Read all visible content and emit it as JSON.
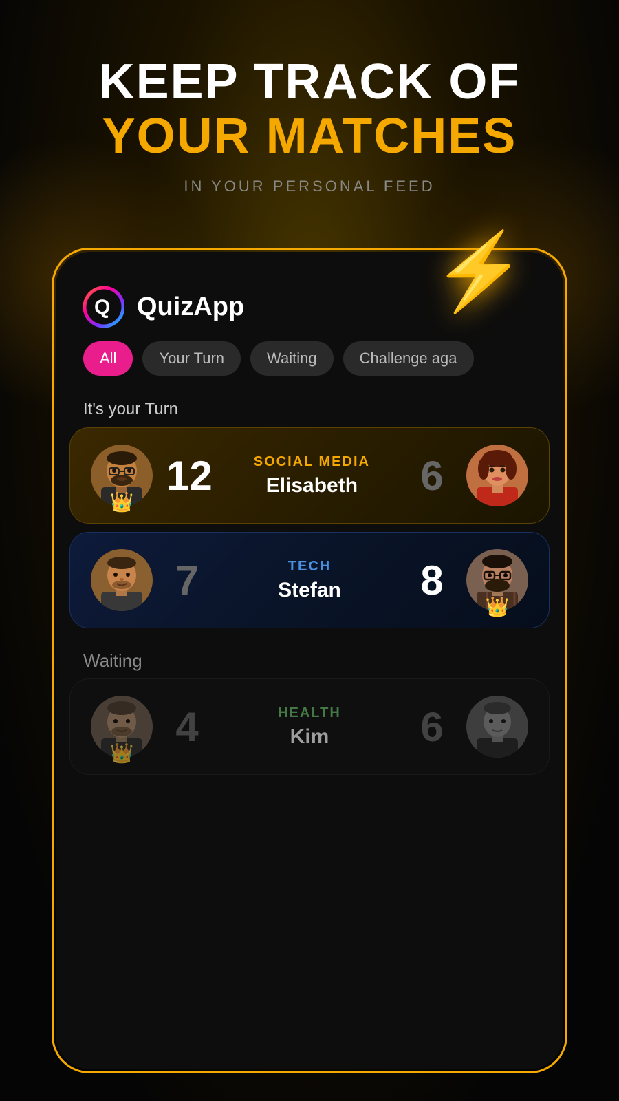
{
  "header": {
    "line1": "KEEP TRACK OF",
    "line2": "YOUR MATCHES",
    "sub": "IN YOUR PERSONAL FEED"
  },
  "app": {
    "name": "QuizApp"
  },
  "tabs": [
    {
      "label": "All",
      "active": true
    },
    {
      "label": "Your Turn",
      "active": false
    },
    {
      "label": "Waiting",
      "active": false
    },
    {
      "label": "Challenge aga",
      "active": false
    }
  ],
  "section_your_turn": "It's your Turn",
  "section_waiting": "Waiting",
  "matches": [
    {
      "id": "match1",
      "category": "SOCIAL MEDIA",
      "opponent_name": "Elisabeth",
      "player_score": "12",
      "opponent_score": "6",
      "player_leading": true,
      "card_type": "gold",
      "section": "your_turn"
    },
    {
      "id": "match2",
      "category": "TECH",
      "opponent_name": "Stefan",
      "player_score": "7",
      "opponent_score": "8",
      "opponent_leading": true,
      "card_type": "blue",
      "section": "your_turn"
    },
    {
      "id": "match3",
      "category": "HEALTH",
      "opponent_name": "Kim",
      "player_score": "4",
      "opponent_score": "6",
      "card_type": "waiting",
      "section": "waiting"
    }
  ]
}
